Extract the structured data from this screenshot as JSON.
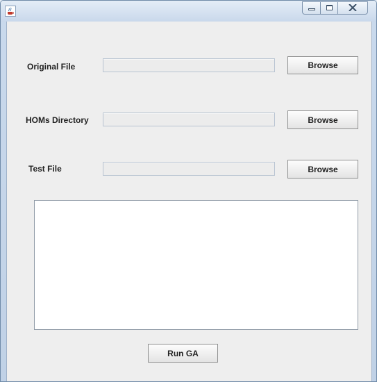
{
  "window": {
    "title": "",
    "icon": "java-cup-icon",
    "controls": [
      "minimize-icon",
      "maximize-icon",
      "close-icon"
    ]
  },
  "form": {
    "original_file": {
      "label": "Original File",
      "value": "",
      "button": "Browse"
    },
    "homs_directory": {
      "label": "HOMs Directory",
      "value": "",
      "button": "Browse"
    },
    "test_file": {
      "label": "Test File",
      "value": "",
      "button": "Browse"
    }
  },
  "output": {
    "text": ""
  },
  "run_button": "Run GA",
  "colors": {
    "titlebar": "#c9d8eb",
    "client": "#eeeeee",
    "output_bg": "#ffffff"
  }
}
